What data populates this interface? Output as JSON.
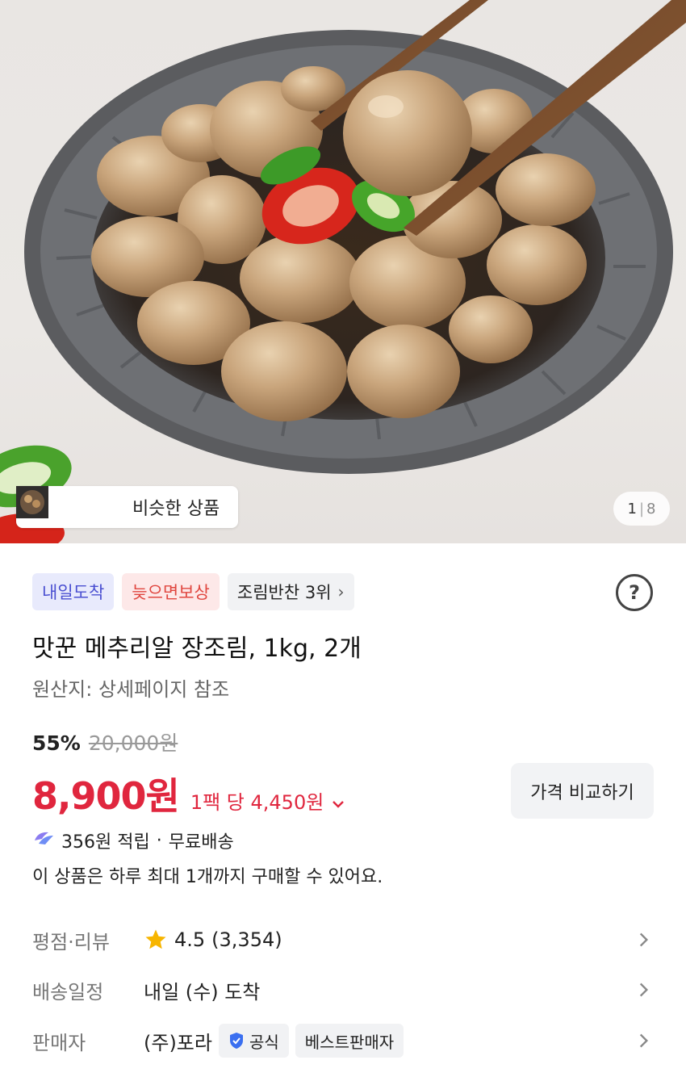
{
  "gallery": {
    "similar_label": "비슷한 상품",
    "counter_current": "1",
    "counter_total": "8"
  },
  "badges": {
    "arrival": "내일도착",
    "compensation": "늦으면보상",
    "rank": "조림반찬 3위"
  },
  "product": {
    "title": "맛꾼 메추리알 장조림, 1kg, 2개",
    "origin": "원산지: 상세페이지 참조",
    "discount": "55%",
    "original_price": "20,000원",
    "price": "8,900원",
    "unit_price": "1팩 당 4,450원",
    "compare_label": "가격 비교하기",
    "reward": "356원 적립",
    "reward_sep": "·",
    "shipping": "무료배송",
    "purchase_limit": "이 상품은 하루 최대 1개까지 구매할 수 있어요."
  },
  "info": {
    "rating_label": "평점·리뷰",
    "rating_value": "4.5",
    "review_count": "(3,354)",
    "delivery_label": "배송일정",
    "delivery_value": "내일 (수) 도착",
    "seller_label": "판매자",
    "seller_name": "(주)포라",
    "official_tag": "공식",
    "best_seller_tag": "베스트판매자"
  },
  "colors": {
    "price_red": "#e0263e",
    "arrival_blue": "#4a4fd1",
    "star_yellow": "#f7b500"
  }
}
